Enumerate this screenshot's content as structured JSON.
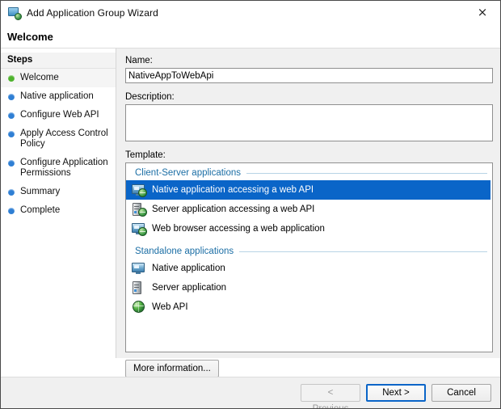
{
  "window": {
    "title": "Add Application Group Wizard",
    "icon": "app-group-icon",
    "close_label": "×"
  },
  "header": {
    "title": "Welcome"
  },
  "sidebar": {
    "title": "Steps",
    "items": [
      {
        "label": "Welcome",
        "state": "current",
        "bullet_color": "#4eb22c"
      },
      {
        "label": "Native application",
        "state": "pending",
        "bullet_color": "#2f7fd4"
      },
      {
        "label": "Configure Web API",
        "state": "pending",
        "bullet_color": "#2f7fd4"
      },
      {
        "label": "Apply Access Control Policy",
        "state": "pending",
        "bullet_color": "#2f7fd4"
      },
      {
        "label": "Configure Application Permissions",
        "state": "pending",
        "bullet_color": "#2f7fd4"
      },
      {
        "label": "Summary",
        "state": "pending",
        "bullet_color": "#2f7fd4"
      },
      {
        "label": "Complete",
        "state": "pending",
        "bullet_color": "#2f7fd4"
      }
    ]
  },
  "form": {
    "name_label": "Name:",
    "name_value": "NativeAppToWebApi",
    "name_placeholder": "",
    "description_label": "Description:",
    "description_value": "",
    "description_placeholder": "",
    "template_label": "Template:"
  },
  "templates": {
    "groups": [
      {
        "title": "Client-Server applications",
        "items": [
          {
            "label": "Native application accessing a web API",
            "icon": "monitor-globe-icon",
            "selected": true
          },
          {
            "label": "Server application accessing a web API",
            "icon": "server-globe-icon",
            "selected": false
          },
          {
            "label": "Web browser accessing a web application",
            "icon": "monitor-globe-icon",
            "selected": false
          }
        ]
      },
      {
        "title": "Standalone applications",
        "items": [
          {
            "label": "Native application",
            "icon": "monitor-icon",
            "selected": false
          },
          {
            "label": "Server application",
            "icon": "server-icon",
            "selected": false
          },
          {
            "label": "Web API",
            "icon": "globe-icon",
            "selected": false
          }
        ]
      }
    ]
  },
  "buttons": {
    "more_information": "More information...",
    "previous": "< Previous",
    "next": "Next >",
    "cancel": "Cancel"
  },
  "colors": {
    "selection_blue": "#0a65c8",
    "group_header_blue": "#1b6ea5",
    "panel_gray": "#f0f0f0",
    "step_done_green": "#4eb22c",
    "step_pending_blue": "#2f7fd4"
  }
}
